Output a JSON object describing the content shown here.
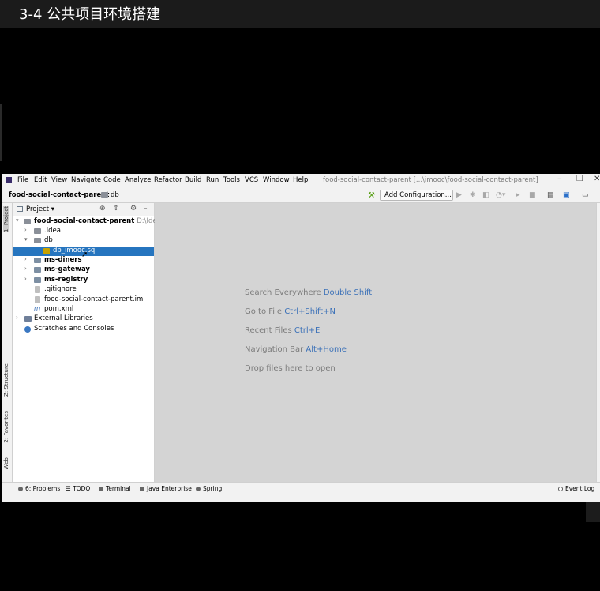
{
  "video": {
    "title": "3-4 公共项目环境搭建"
  },
  "menu": {
    "items": [
      "File",
      "Edit",
      "View",
      "Navigate",
      "Code",
      "Analyze",
      "Refactor",
      "Build",
      "Run",
      "Tools",
      "VCS",
      "Window",
      "Help"
    ],
    "window_title": "food-social-contact-parent [...\\imooc\\food-social-contact-parent]"
  },
  "navbar": {
    "project": "food-social-contact-parent",
    "folder": "db",
    "config_button": "Add Configuration..."
  },
  "project_panel": {
    "title": "Project",
    "tree": [
      {
        "label": "food-social-contact-parent",
        "hint": "D:\\IdeaPro",
        "bold": true
      },
      {
        "label": ".idea"
      },
      {
        "label": "db"
      },
      {
        "label": "db_imooc.sql",
        "selected": true
      },
      {
        "label": "ms-diners",
        "bold": true
      },
      {
        "label": "ms-gateway",
        "bold": true
      },
      {
        "label": "ms-registry",
        "bold": true
      },
      {
        "label": ".gitignore"
      },
      {
        "label": "food-social-contact-parent.iml"
      },
      {
        "label": "pom.xml"
      },
      {
        "label": "External Libraries"
      },
      {
        "label": "Scratches and Consoles"
      }
    ]
  },
  "side_tabs": {
    "project": "1: Project",
    "structure": "Z: Structure",
    "favorites": "2: Favorites",
    "web": "Web"
  },
  "editor_hints": [
    {
      "text": "Search Everywhere",
      "shortcut": "Double Shift"
    },
    {
      "text": "Go to File",
      "shortcut": "Ctrl+Shift+N"
    },
    {
      "text": "Recent Files",
      "shortcut": "Ctrl+E"
    },
    {
      "text": "Navigation Bar",
      "shortcut": "Alt+Home"
    },
    {
      "text": "Drop files here to open",
      "shortcut": ""
    }
  ],
  "statusbar": {
    "problems": "6: Problems",
    "todo": "TODO",
    "terminal": "Terminal",
    "java_enterprise": "Java Enterprise",
    "spring": "Spring",
    "event_log": "Event Log"
  }
}
